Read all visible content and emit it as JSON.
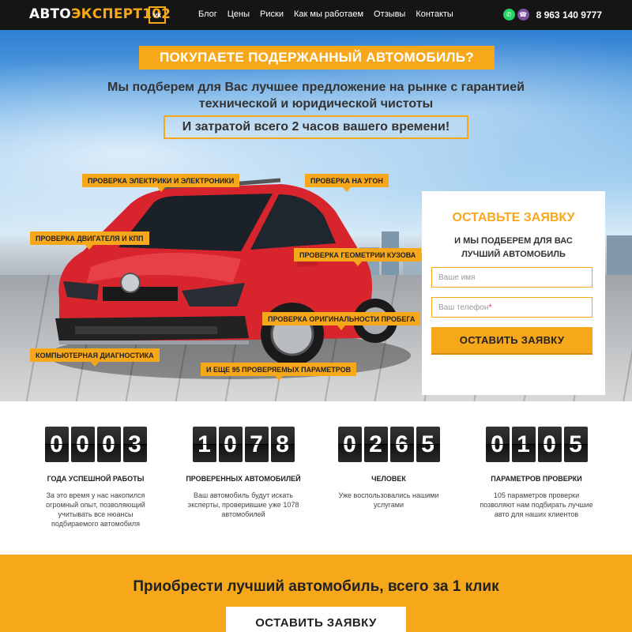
{
  "header": {
    "logo_white": "АВТО",
    "logo_yellow": "ЭКСПЕРТ102",
    "vk_label": "vk",
    "nav": [
      "Блог",
      "Цены",
      "Риски",
      "Как мы работаем",
      "Отзывы",
      "Контакты"
    ],
    "phone": "8 963 140 9777",
    "colors": {
      "bg": "#151515",
      "accent": "#f7a81a"
    }
  },
  "hero": {
    "title": "ПОКУПАЕТЕ ПОДЕРЖАННЫЙ АВТОМОБИЛЬ?",
    "subtitle_line1": "Мы подберем для Вас лучшее предложение на рынке с гарантией",
    "subtitle_line2": "технической и юридической чистоты",
    "highlight": "И затратой всего 2 часов вашего времени!",
    "tags": [
      "ПРОВЕРКА ЭЛЕКТРИКИ И ЭЛЕКТРОНИКИ",
      "ПРОВЕРКА НА УГОН",
      "ПРОВЕРКА ДВИГАТЕЛЯ И КПП",
      "ПРОВЕРКА ГЕОМЕТРИИ КУЗОВА",
      "ПРОВЕРКА ОРИГИНАЛЬНОСТИ ПРОБЕГА",
      "КОМПЬЮТЕРНАЯ ДИАГНОСТИКА",
      "И ЕЩЕ 95 ПРОВЕРЯЕМЫХ ПАРАМЕТРОВ"
    ]
  },
  "form": {
    "title": "ОСТАВЬТЕ ЗАЯВКУ",
    "sub_line1": "И МЫ ПОДБЕРЕМ ДЛЯ ВАС",
    "sub_line2": "ЛУЧШИЙ АВТОМОБИЛЬ",
    "name_placeholder": "Ваше имя",
    "phone_placeholder": "Ваш телефон",
    "required_mark": "*",
    "submit": "ОСТАВИТЬ ЗАЯВКУ"
  },
  "stats": [
    {
      "digits": [
        "0",
        "0",
        "0",
        "3"
      ],
      "label": "ГОДА УСПЕШНОЙ РАБОТЫ",
      "desc": "За это время у нас накопился огромный опыт, позволяющий учитывать все нюансы подбираемого автомобиля"
    },
    {
      "digits": [
        "1",
        "0",
        "7",
        "8"
      ],
      "label": "ПРОВЕРЕННЫХ АВТОМОБИЛЕЙ",
      "desc": "Ваш автомобиль будут искать эксперты, проверившие уже 1078 автомобилей"
    },
    {
      "digits": [
        "0",
        "2",
        "6",
        "5"
      ],
      "label": "ЧЕЛОВЕК",
      "desc": "Уже воспользовались нашими услугами"
    },
    {
      "digits": [
        "0",
        "1",
        "0",
        "5"
      ],
      "label": "ПАРАМЕТРОВ ПРОВЕРКИ",
      "desc": "105 параметров проверки позволяют нам подбирать лучшие авто для наших клиентов"
    }
  ],
  "cta": {
    "title": "Приобрести лучший автомобиль, всего за 1 клик",
    "button": "ОСТАВИТЬ ЗАЯВКУ"
  }
}
